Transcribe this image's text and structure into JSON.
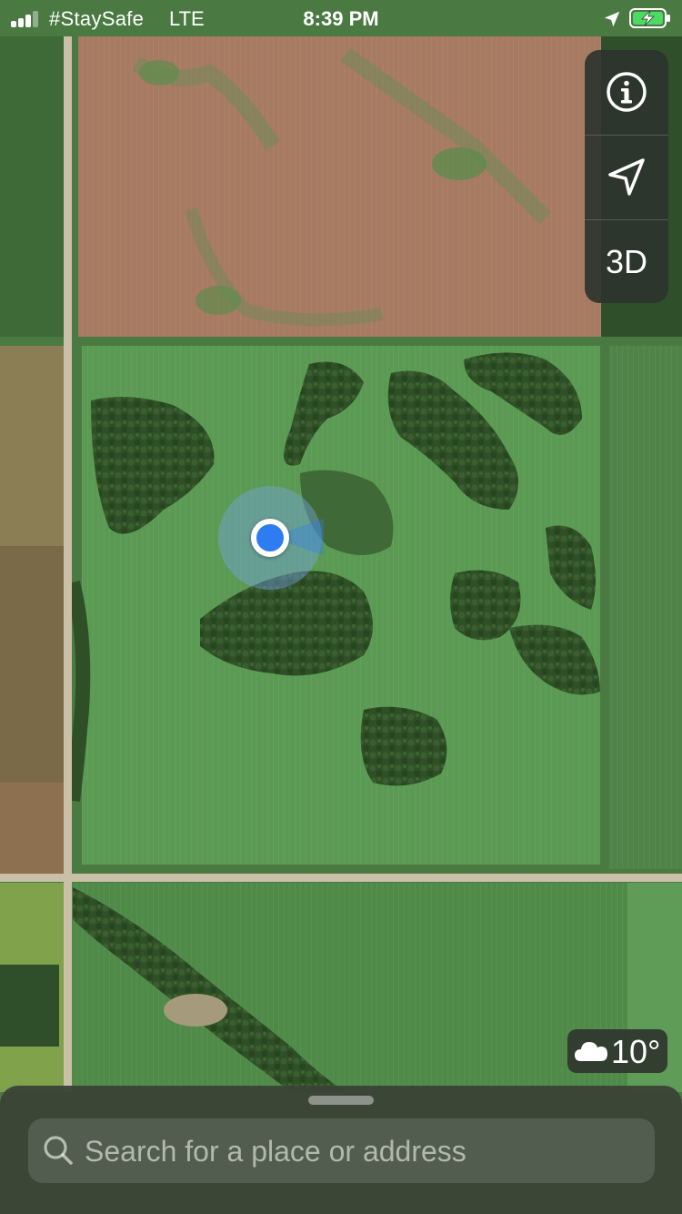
{
  "status_bar": {
    "carrier": "#StaySafe",
    "network": "LTE",
    "time": "8:39 PM",
    "signal_bars_active": 3,
    "signal_bars_total": 4,
    "location_services_icon": "location-arrow-icon",
    "battery_icon": "battery-charging-icon",
    "battery_color": "#4cd964"
  },
  "map": {
    "map_type": "satellite",
    "user_location_icon": "user-location-dot",
    "user_location_color": "#2d7cf2"
  },
  "map_controls": {
    "info_icon": "info-icon",
    "tracking_icon": "navigation-arrow-icon",
    "three_d_label": "3D"
  },
  "weather": {
    "icon": "cloud-icon",
    "temperature": "10°"
  },
  "bottom_sheet": {
    "search_placeholder": "Search for a place or address",
    "search_icon": "search-icon"
  }
}
